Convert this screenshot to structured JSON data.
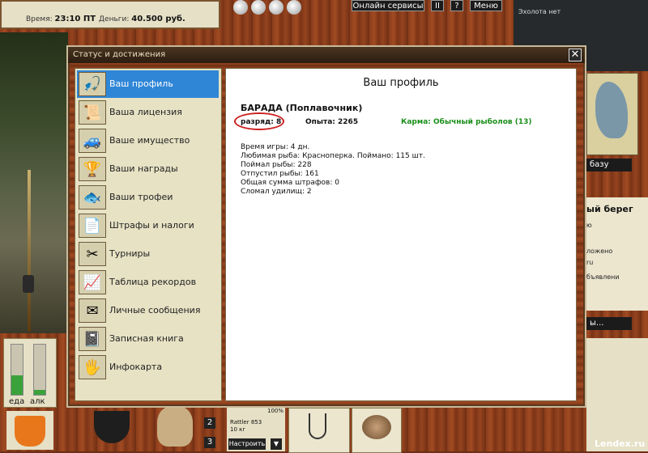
{
  "hud": {
    "time_label": "Время:",
    "time_value": "23:10 ПТ",
    "money_label": "Деньги:",
    "money_value": "40.500 руб."
  },
  "top_buttons": {
    "online": "Онлайн сервисы",
    "pause": "II",
    "help": "?",
    "menu": "Меню"
  },
  "sonar": {
    "label": "Эхолота нет"
  },
  "right_panel": {
    "base_button": "базу",
    "location_title": "ый берег",
    "fragment1": "ю",
    "fragment2": "ложено",
    "fragment3": "ru",
    "fragment4": "бъявлени",
    "dots_button": "ы..."
  },
  "meters": {
    "food": "еда",
    "alcohol": "алк"
  },
  "bottom": {
    "rod_name": "Rattler 853",
    "rod_weight": "10 кг",
    "percent": "100%",
    "configure": "Настроить",
    "count1": "2",
    "count2": "3",
    "watermark": "Lendex.ru"
  },
  "dialog": {
    "title": "Статус и достижения",
    "close": "✕",
    "nav": [
      {
        "label": "Ваш профиль",
        "icon": "🎣"
      },
      {
        "label": "Ваша лицензия",
        "icon": "📜"
      },
      {
        "label": "Ваше имущество",
        "icon": "🚙"
      },
      {
        "label": "Ваши награды",
        "icon": "🏆"
      },
      {
        "label": "Ваши трофеи",
        "icon": "🐟"
      },
      {
        "label": "Штрафы и налоги",
        "icon": "📄"
      },
      {
        "label": "Турниры",
        "icon": "✂"
      },
      {
        "label": "Таблица рекордов",
        "icon": "📈"
      },
      {
        "label": "Личные сообщения",
        "icon": "✉"
      },
      {
        "label": "Записная книга",
        "icon": "📓"
      },
      {
        "label": "Инфокарта",
        "icon": "🖐"
      }
    ],
    "active_index": 0,
    "profile": {
      "heading": "Ваш профиль",
      "player_name": "БАРАДА (Поплавочник)",
      "rank": "разряд: 8",
      "experience": "Опыта: 2265",
      "karma": "Карма: Обычный рыболов (13)",
      "stats": [
        "Время игры: 4 дн.",
        "Любимая рыба: Красноперка. Поймано: 115 шт.",
        "Поймал рыбы: 228",
        "Отпустил рыбы: 161",
        "Общая сумма штрафов: 0",
        "Сломал удилищ: 2"
      ]
    }
  },
  "colors": {
    "active_nav": "#2f86d6",
    "karma": "#1a8f1a",
    "rank_circle": "#cc2020"
  }
}
